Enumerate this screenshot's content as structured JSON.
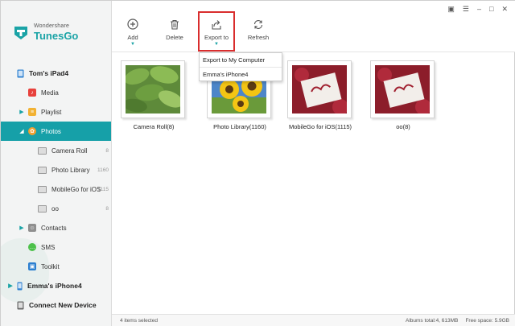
{
  "app": {
    "brand_sub": "Wondershare",
    "brand_name": "TunesGo",
    "accent_color": "#16a0a8",
    "highlight_color": "#d92d2d"
  },
  "window_controls": {
    "items": [
      "feedback-icon",
      "menu-icon",
      "minimize-icon",
      "maximize-icon",
      "close-icon"
    ]
  },
  "toolbar": {
    "add_label": "Add",
    "delete_label": "Delete",
    "export_label": "Export to",
    "refresh_label": "Refresh"
  },
  "export_menu": {
    "items": [
      "Export to My Computer",
      "Emma's iPhone4"
    ]
  },
  "sidebar": {
    "device1": "Tom's iPad4",
    "media": "Media",
    "playlist": "Playlist",
    "photos": "Photos",
    "sub_items": [
      {
        "label": "Camera Roll",
        "count": "8"
      },
      {
        "label": "Photo Library",
        "count": "1160"
      },
      {
        "label": "MobileGo for iOS",
        "count": "1115"
      },
      {
        "label": "oo",
        "count": "8"
      }
    ],
    "contacts": "Contacts",
    "sms": "SMS",
    "toolkit": "Toolkit",
    "device2": "Emma's iPhone4",
    "connect": "Connect New Device"
  },
  "albums": [
    {
      "label": "Camera Roll(8)",
      "thumb": "green-leaves"
    },
    {
      "label": "Photo Library(1160)",
      "thumb": "sunflower"
    },
    {
      "label": "MobileGo for iOS(1115)",
      "thumb": "red-card"
    },
    {
      "label": "oo(8)",
      "thumb": "red-card"
    }
  ],
  "status": {
    "selected": "4 items selected",
    "totals": "Albums total:4, 613MB",
    "free_space": "Free space: 5.9GB"
  }
}
